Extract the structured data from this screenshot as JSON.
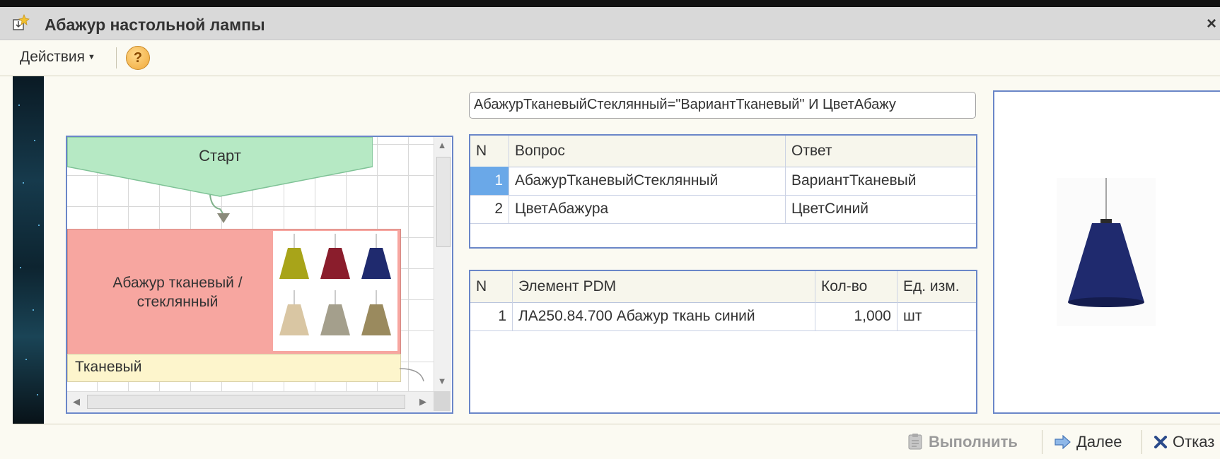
{
  "window": {
    "title": "Абажур настольной лампы",
    "close_glyph": "×"
  },
  "toolbar": {
    "actions_label": "Действия",
    "help_glyph": "?"
  },
  "flowchart": {
    "start_label": "Старт",
    "block_label": "Абажур тканевый / стеклянный",
    "answer_label": "Тканевый",
    "thumb_colors": [
      "#a8a419",
      "#8a1d2c",
      "#1f2a6e",
      "#d9c6a3",
      "#a49f8c",
      "#9a8a5e"
    ],
    "start_color": "#b6e9c4",
    "block_color": "#f7a6a0"
  },
  "condition": {
    "text": "АбажурТканевыйСтеклянный=\"ВариантТканевый\" И ЦветАбажу"
  },
  "questions_table": {
    "headers": {
      "n": "N",
      "question": "Вопрос",
      "answer": "Ответ"
    },
    "rows": [
      {
        "n": "1",
        "question": "АбажурТканевыйСтеклянный",
        "answer": "ВариантТканевый"
      },
      {
        "n": "2",
        "question": "ЦветАбажура",
        "answer": "ЦветСиний"
      }
    ]
  },
  "pdm_table": {
    "headers": {
      "n": "N",
      "element": "Элемент PDM",
      "qty": "Кол-во",
      "unit": "Ед. изм."
    },
    "rows": [
      {
        "n": "1",
        "element": "ЛА250.84.700 Абажур ткань синий",
        "qty": "1,000",
        "unit": "шт"
      }
    ]
  },
  "preview": {
    "lamp_color": "#1f2a6e"
  },
  "footer": {
    "run_label": "Выполнить",
    "next_label": "Далее",
    "cancel_label": "Отказ"
  }
}
